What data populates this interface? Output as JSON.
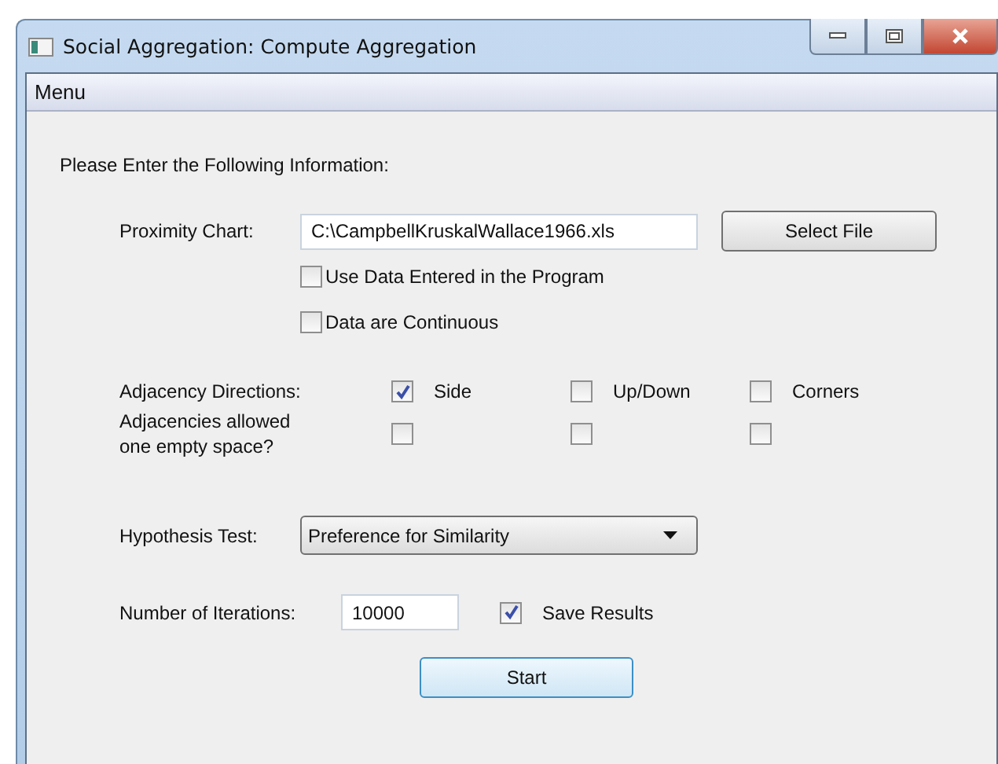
{
  "window": {
    "title": "Social Aggregation: Compute Aggregation"
  },
  "menu": [
    {
      "label": "Menu"
    }
  ],
  "form": {
    "instruction": "Please Enter the Following Information:",
    "proximity": {
      "label": "Proximity Chart:",
      "value": "C:\\CampbellKruskalWallace1966.xls",
      "button": "Select File"
    },
    "options": [
      {
        "label": "Use Data Entered in the Program",
        "checked": false
      },
      {
        "label": "Data are Continuous",
        "checked": false
      }
    ],
    "adjacency": {
      "label": "Adjacency Directions:",
      "directions": [
        {
          "label": "Side",
          "checked": true
        },
        {
          "label": "Up/Down",
          "checked": false
        },
        {
          "label": "Corners",
          "checked": false
        }
      ],
      "empty_label": "Adjacencies allowed one empty space?",
      "empty": [
        {
          "checked": false
        },
        {
          "checked": false
        },
        {
          "checked": false
        }
      ]
    },
    "hypothesis": {
      "label": "Hypothesis Test:",
      "value": "Preference for Similarity"
    },
    "iterations": {
      "label": "Number of Iterations:",
      "value": "10000"
    },
    "save": {
      "label": "Save Results",
      "checked": true
    },
    "start": "Start"
  }
}
